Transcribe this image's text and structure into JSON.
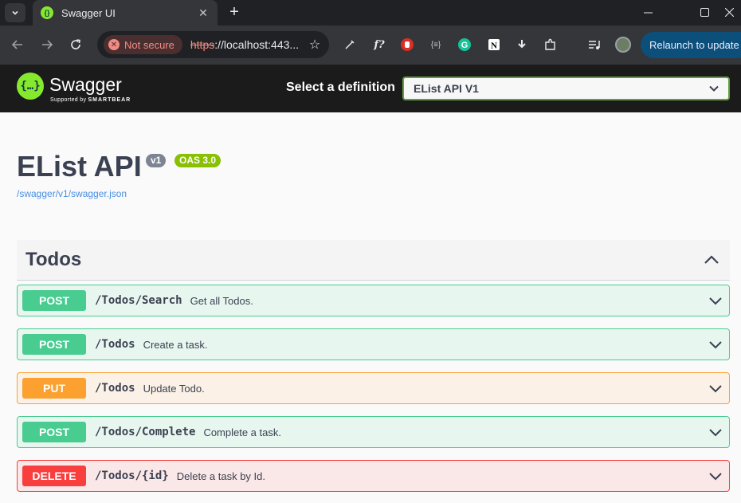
{
  "browser": {
    "tab_title": "Swagger UI",
    "not_secure_label": "Not secure",
    "url_scheme": "https",
    "url_rest": "://localhost:443...",
    "relaunch_label": "Relaunch to update"
  },
  "topbar": {
    "brand": "Swagger",
    "tagline_prefix": "Supported by",
    "tagline_brand": "SMARTBEAR",
    "select_label": "Select a definition",
    "selected_definition": "EList API V1"
  },
  "info": {
    "title": "EList API",
    "version": "v1",
    "oas": "OAS 3.0",
    "spec_url": "/swagger/v1/swagger.json"
  },
  "tag": {
    "name": "Todos"
  },
  "operations": [
    {
      "method": "POST",
      "path": "/Todos/Search",
      "summary": "Get all Todos."
    },
    {
      "method": "POST",
      "path": "/Todos",
      "summary": "Create a task."
    },
    {
      "method": "PUT",
      "path": "/Todos",
      "summary": "Update Todo."
    },
    {
      "method": "POST",
      "path": "/Todos/Complete",
      "summary": "Complete a task."
    },
    {
      "method": "DELETE",
      "path": "/Todos/{id}",
      "summary": "Delete a task by Id."
    }
  ],
  "colors": {
    "post": "#49cc90",
    "put": "#fca130",
    "delete": "#f93e3e",
    "swagger_green": "#85ea2d"
  }
}
